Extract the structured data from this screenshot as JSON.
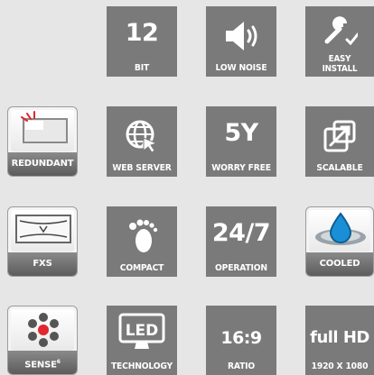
{
  "tiles": {
    "bit": {
      "value": "12",
      "label": "BIT"
    },
    "low_noise": {
      "label": "LOW NOISE",
      "icon": "speaker-icon"
    },
    "easy_install": {
      "label_line1": "EASY",
      "label_line2": "INSTALL",
      "icon": "wrench-icon"
    },
    "web_server": {
      "label": "WEB SERVER",
      "icon": "globe-cursor-icon"
    },
    "worry_free": {
      "value": "5Y",
      "label": "WORRY FREE"
    },
    "scalable": {
      "label": "SCALABLE",
      "icon": "expand-arrow-icon"
    },
    "compact": {
      "label": "COMPACT",
      "icon": "footprint-icon"
    },
    "operation": {
      "value": "24/7",
      "label": "OPERATION"
    },
    "technology": {
      "label": "TECHNOLOGY",
      "icon": "led-monitor-icon",
      "icon_text": "LED"
    },
    "ratio": {
      "value": "16:9",
      "label": "RATIO"
    },
    "full_hd": {
      "value": "full HD",
      "label": "1920 X 1080"
    }
  },
  "badges": {
    "redundant": {
      "label": "REDUNDANT",
      "icon": "screen-icon"
    },
    "fxs": {
      "label": "FXS",
      "icon": "fxs-frame-icon"
    },
    "cooled": {
      "label": "COOLED",
      "icon": "water-drop-icon"
    },
    "sense": {
      "label": "SENSE",
      "label_sup": "6",
      "icon": "sensor-dots-icon"
    }
  },
  "colors": {
    "tile_gray": "#7a7a7a",
    "badge_band": "#6e6e6e",
    "accent_red": "#e0282e",
    "accent_blue": "#1a8fd6"
  }
}
